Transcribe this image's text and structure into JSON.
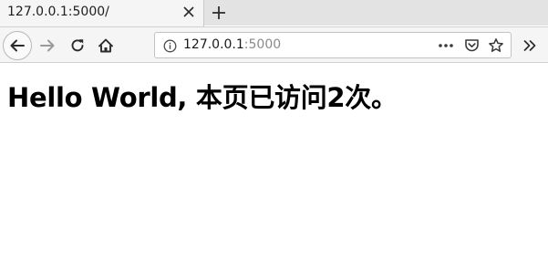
{
  "tab": {
    "title": "127.0.0.1:5000/"
  },
  "address_bar": {
    "host": "127.0.0.1",
    "port": ":5000"
  },
  "icons": {
    "close_tab": "close-icon",
    "new_tab": "plus-icon",
    "back": "arrow-left-icon",
    "forward": "arrow-right-icon",
    "reload": "reload-icon",
    "home": "home-icon",
    "site_info": "info-icon",
    "page_actions": "more-icon",
    "pocket": "pocket-icon",
    "bookmark": "star-icon",
    "overflow": "chevron-double-right-icon"
  },
  "page": {
    "heading": "Hello World, 本页已访问2次。"
  }
}
